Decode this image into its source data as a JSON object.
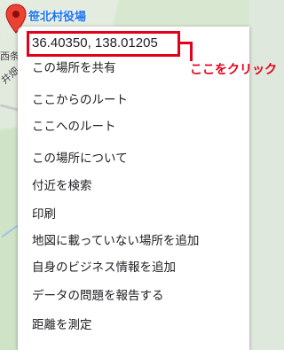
{
  "map": {
    "place_label": "笹北村役場",
    "side_texts": [
      "西条",
      "井畑"
    ]
  },
  "menu": {
    "coords": "36.40350, 138.01205",
    "items": [
      "この場所を共有",
      "ここからのルート",
      "ここへのルート",
      "この場所について",
      "付近を検索",
      "印刷",
      "地図に載っていない場所を追加",
      "自身のビジネス情報を追加",
      "データの問題を報告する",
      "距離を測定"
    ]
  },
  "annotation": {
    "text": "ここをクリック",
    "color": "#e3001b"
  }
}
